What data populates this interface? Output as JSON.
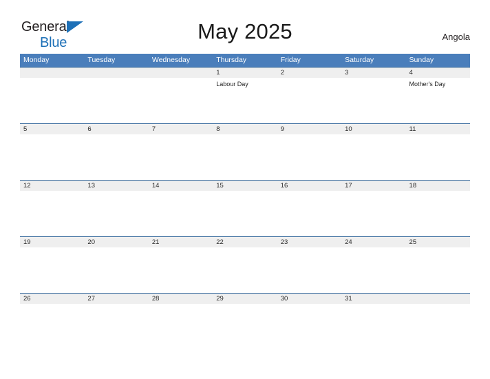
{
  "logo": {
    "word_dark": "General",
    "word_blue": "Blue",
    "triangle_color": "#1d70b7"
  },
  "header": {
    "title": "May 2025",
    "country": "Angola"
  },
  "colors": {
    "header_blue": "#4a7ebb",
    "row_divider_blue": "#2f6499",
    "date_band_gray": "#efefef",
    "logo_blue": "#1d70b7"
  },
  "calendar": {
    "weekdays": [
      "Monday",
      "Tuesday",
      "Wednesday",
      "Thursday",
      "Friday",
      "Saturday",
      "Sunday"
    ],
    "weeks": [
      {
        "days": [
          {
            "date": "",
            "events": []
          },
          {
            "date": "",
            "events": []
          },
          {
            "date": "",
            "events": []
          },
          {
            "date": "1",
            "events": [
              "Labour Day"
            ]
          },
          {
            "date": "2",
            "events": []
          },
          {
            "date": "3",
            "events": []
          },
          {
            "date": "4",
            "events": [
              "Mother's Day"
            ]
          }
        ]
      },
      {
        "days": [
          {
            "date": "5",
            "events": []
          },
          {
            "date": "6",
            "events": []
          },
          {
            "date": "7",
            "events": []
          },
          {
            "date": "8",
            "events": []
          },
          {
            "date": "9",
            "events": []
          },
          {
            "date": "10",
            "events": []
          },
          {
            "date": "11",
            "events": []
          }
        ]
      },
      {
        "days": [
          {
            "date": "12",
            "events": []
          },
          {
            "date": "13",
            "events": []
          },
          {
            "date": "14",
            "events": []
          },
          {
            "date": "15",
            "events": []
          },
          {
            "date": "16",
            "events": []
          },
          {
            "date": "17",
            "events": []
          },
          {
            "date": "18",
            "events": []
          }
        ]
      },
      {
        "days": [
          {
            "date": "19",
            "events": []
          },
          {
            "date": "20",
            "events": []
          },
          {
            "date": "21",
            "events": []
          },
          {
            "date": "22",
            "events": []
          },
          {
            "date": "23",
            "events": []
          },
          {
            "date": "24",
            "events": []
          },
          {
            "date": "25",
            "events": []
          }
        ]
      },
      {
        "days": [
          {
            "date": "26",
            "events": []
          },
          {
            "date": "27",
            "events": []
          },
          {
            "date": "28",
            "events": []
          },
          {
            "date": "29",
            "events": []
          },
          {
            "date": "30",
            "events": []
          },
          {
            "date": "31",
            "events": []
          },
          {
            "date": "",
            "events": []
          }
        ]
      }
    ]
  }
}
